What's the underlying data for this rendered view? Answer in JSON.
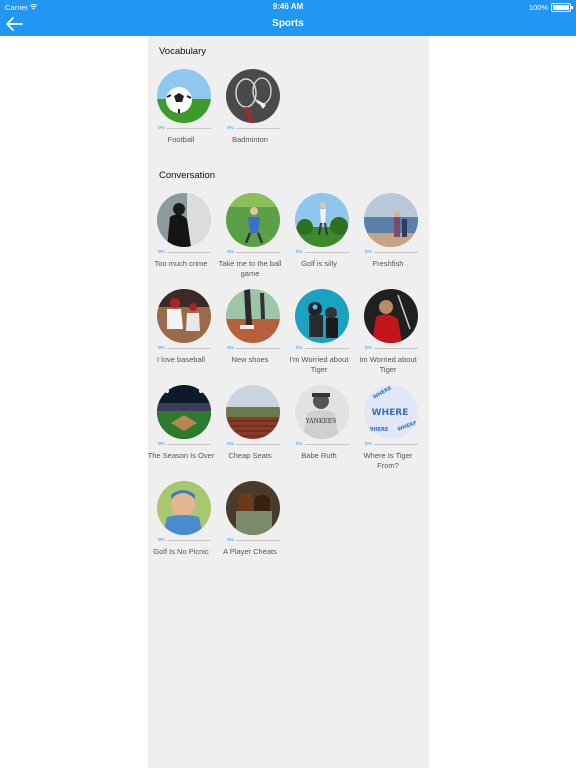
{
  "status_bar": {
    "carrier": "Carrier",
    "time": "9:46 AM",
    "battery": "100%"
  },
  "nav": {
    "title": "Sports",
    "back_icon": "arrow-left-icon"
  },
  "colors": {
    "accent": "#2196f3",
    "panel": "#efefef"
  },
  "sections": [
    {
      "title": "Vocabulary",
      "items": [
        {
          "label": "Football",
          "progress": "0%"
        },
        {
          "label": "Badminton",
          "progress": "0%"
        }
      ]
    },
    {
      "title": "Conversation",
      "items": [
        {
          "label": "Too much crime",
          "progress": "0%"
        },
        {
          "label": "Take me to the ball game",
          "progress": "0%"
        },
        {
          "label": "Golf is silly",
          "progress": "0%"
        },
        {
          "label": "Freshfish",
          "progress": "0%"
        },
        {
          "label": "I love baseball",
          "progress": "0%"
        },
        {
          "label": "New shoes",
          "progress": "0%"
        },
        {
          "label": "I'm Worried about Tiger",
          "progress": "0%"
        },
        {
          "label": "Im Worried about Tiger",
          "progress": "0%"
        },
        {
          "label": "The Season Is Over",
          "progress": "0%"
        },
        {
          "label": "Cheap Seats",
          "progress": "0%"
        },
        {
          "label": "Babe Ruth",
          "progress": "0%"
        },
        {
          "label": "Where Is Tiger From?",
          "progress": "0%"
        },
        {
          "label": "Golf Is No Picnic",
          "progress": "0%"
        },
        {
          "label": "A Player Cheats",
          "progress": "0%"
        }
      ]
    }
  ]
}
